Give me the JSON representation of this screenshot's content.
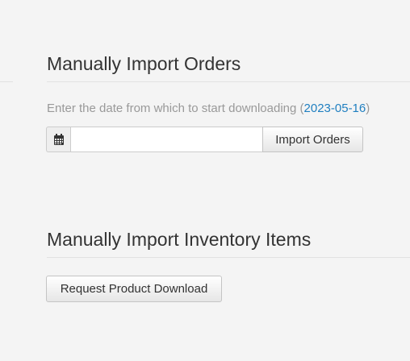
{
  "orders_section": {
    "title": "Manually Import Orders",
    "hint_prefix": "Enter the date from which to start downloading (",
    "hint_date": "2023-05-16",
    "hint_suffix": ")",
    "date_input_value": "",
    "import_button_label": "Import Orders",
    "calendar_icon": "calendar-icon"
  },
  "inventory_section": {
    "title": "Manually Import Inventory Items",
    "request_button_label": "Request Product Download"
  },
  "colors": {
    "link": "#1f7fc0",
    "hint_text": "#999999",
    "background": "#f4f4f4"
  }
}
